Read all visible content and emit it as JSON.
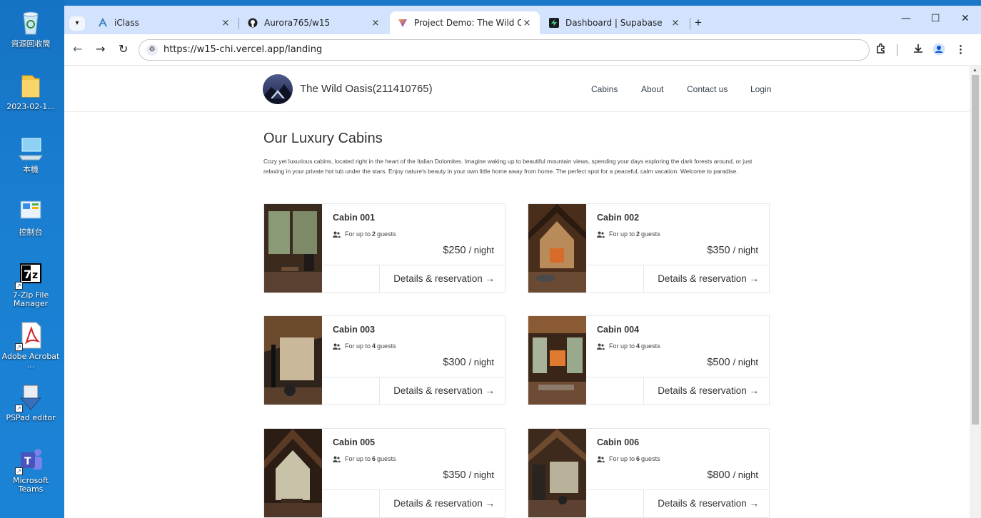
{
  "desktop": {
    "icons": [
      {
        "label": "資源回收筒",
        "icon": "recycle-bin-icon"
      },
      {
        "label": "2023-02-1...",
        "icon": "folder-icon"
      },
      {
        "label": "本機",
        "icon": "computer-icon"
      },
      {
        "label": "控制台",
        "icon": "control-panel-icon"
      },
      {
        "label": "7-Zip File Manager",
        "icon": "7zip-icon"
      },
      {
        "label": "Adobe Acrobat ...",
        "icon": "acrobat-icon"
      },
      {
        "label": "PSPad editor",
        "icon": "pspad-icon"
      },
      {
        "label": "Microsoft Teams",
        "icon": "teams-icon"
      }
    ]
  },
  "browser": {
    "tabs": [
      {
        "title": "iClass",
        "icon": "iclass-icon",
        "active": false
      },
      {
        "title": "Aurora765/w15",
        "icon": "github-icon",
        "active": false
      },
      {
        "title": "Project Demo: The Wild Oasis",
        "icon": "vercel-icon",
        "active": true
      },
      {
        "title": "Dashboard | Supabase",
        "icon": "supabase-icon",
        "active": false
      }
    ],
    "close_glyph": "×",
    "newtab_glyph": "+",
    "url": "https://w15-chi.vercel.app/landing",
    "window_controls": {
      "minimize": "—",
      "maximize": "☐",
      "close": "✕"
    },
    "nav": {
      "back": "←",
      "forward": "→",
      "reload": "↻"
    }
  },
  "site": {
    "brand": "The Wild Oasis(211410765)",
    "nav": [
      "Cabins",
      "About",
      "Contact us",
      "Login"
    ],
    "heading": "Our Luxury Cabins",
    "intro": "Cozy yet luxurious cabins, located right in the heart of the Italian Dolomites. Imagine waking up to beautiful mountain views, spending your days exploring the dark forests around, or just relaxing in your private hot tub under the stars. Enjoy nature's beauty in your own little home away from home. The perfect spot for a peaceful, calm vacation. Welcome to paradise.",
    "guest_prefix": "For up to",
    "guest_suffix": "guests",
    "price_unit": "/ night",
    "details_label": "Details & reservation →",
    "cabins": [
      {
        "name": "Cabin 001",
        "guests": "2",
        "price": "$250"
      },
      {
        "name": "Cabin 002",
        "guests": "2",
        "price": "$350"
      },
      {
        "name": "Cabin 003",
        "guests": "4",
        "price": "$300"
      },
      {
        "name": "Cabin 004",
        "guests": "4",
        "price": "$500"
      },
      {
        "name": "Cabin 005",
        "guests": "6",
        "price": "$350"
      },
      {
        "name": "Cabin 006",
        "guests": "6",
        "price": "$800"
      }
    ]
  },
  "colors": {
    "desktop": "#1a78c8",
    "tabbar": "#d3e3fd",
    "accent": "#0b57d0"
  }
}
